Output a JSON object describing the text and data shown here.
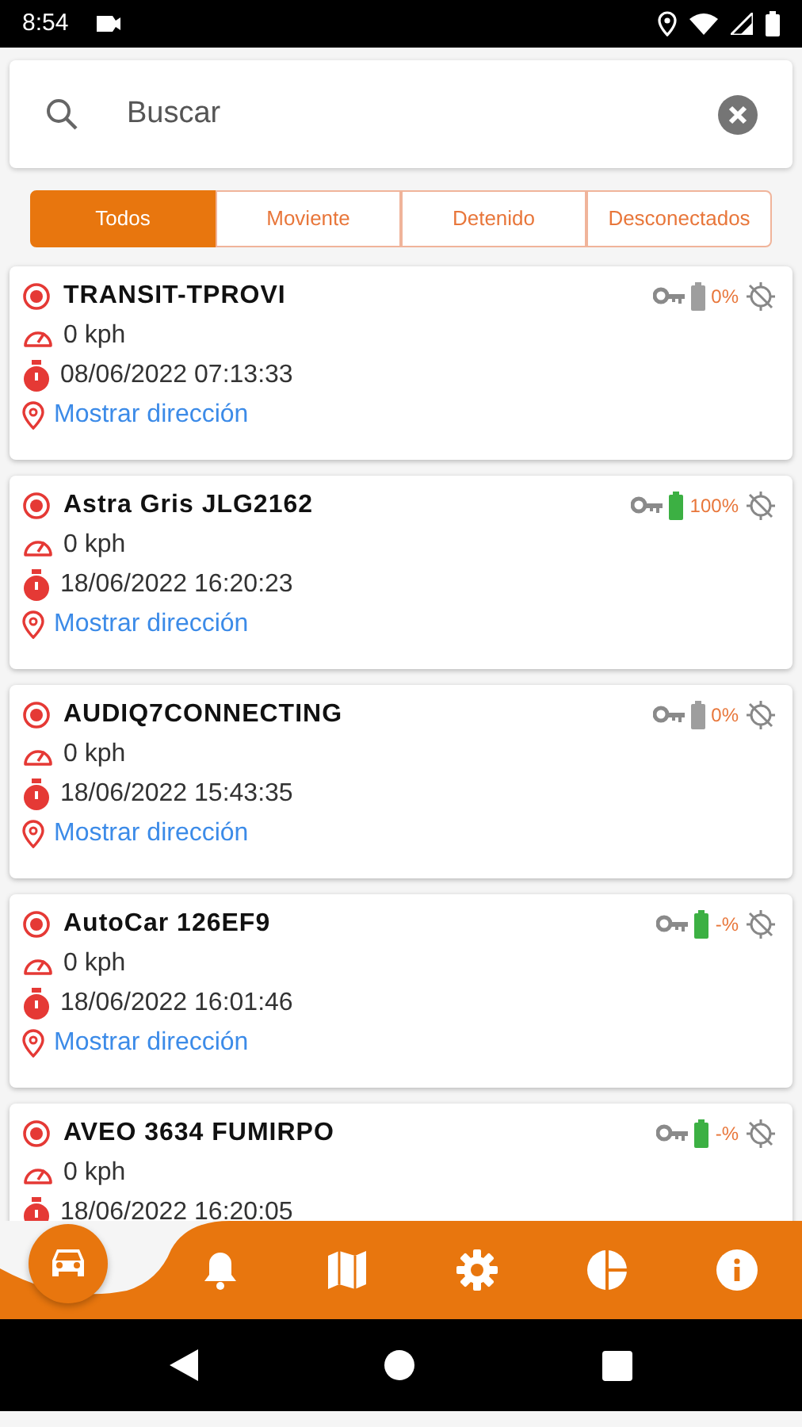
{
  "status_bar": {
    "time": "8:54"
  },
  "search": {
    "placeholder": "Buscar"
  },
  "tabs": [
    {
      "label": "Todos",
      "selected": true
    },
    {
      "label": "Moviente",
      "selected": false
    },
    {
      "label": "Detenido",
      "selected": false
    },
    {
      "label": "Desconectados",
      "selected": false
    }
  ],
  "vehicles": [
    {
      "name": "TRANSIT-TPROVI",
      "speed": "0 kph",
      "timestamp": "08/06/2022 07:13:33",
      "address_link": "Mostrar dirección",
      "battery": {
        "color": "#9e9e9e",
        "reading": "0%"
      }
    },
    {
      "name": "Astra Gris JLG2162",
      "speed": "0 kph",
      "timestamp": "18/06/2022 16:20:23",
      "address_link": "Mostrar dirección",
      "battery": {
        "color": "#3cb043",
        "reading": "100%"
      }
    },
    {
      "name": "AUDIQ7CONNECTING",
      "speed": "0 kph",
      "timestamp": "18/06/2022 15:43:35",
      "address_link": "Mostrar dirección",
      "battery": {
        "color": "#9e9e9e",
        "reading": "0%"
      }
    },
    {
      "name": "AutoCar 126EF9",
      "speed": "0 kph",
      "timestamp": "18/06/2022 16:01:46",
      "address_link": "Mostrar dirección",
      "battery": {
        "color": "#3cb043",
        "reading": "-%"
      }
    },
    {
      "name": "AVEO 3634 FUMIRPO",
      "speed": "0 kph",
      "timestamp": "18/06/2022 16:20:05",
      "battery": {
        "color": "#3cb043",
        "reading": "-%"
      }
    }
  ],
  "bottom_nav": [
    {
      "kind": "car",
      "selected": true
    },
    {
      "kind": "bell",
      "selected": false
    },
    {
      "kind": "map",
      "selected": false
    },
    {
      "kind": "gear",
      "selected": false
    },
    {
      "kind": "pie",
      "selected": false
    },
    {
      "kind": "info",
      "selected": false
    }
  ]
}
